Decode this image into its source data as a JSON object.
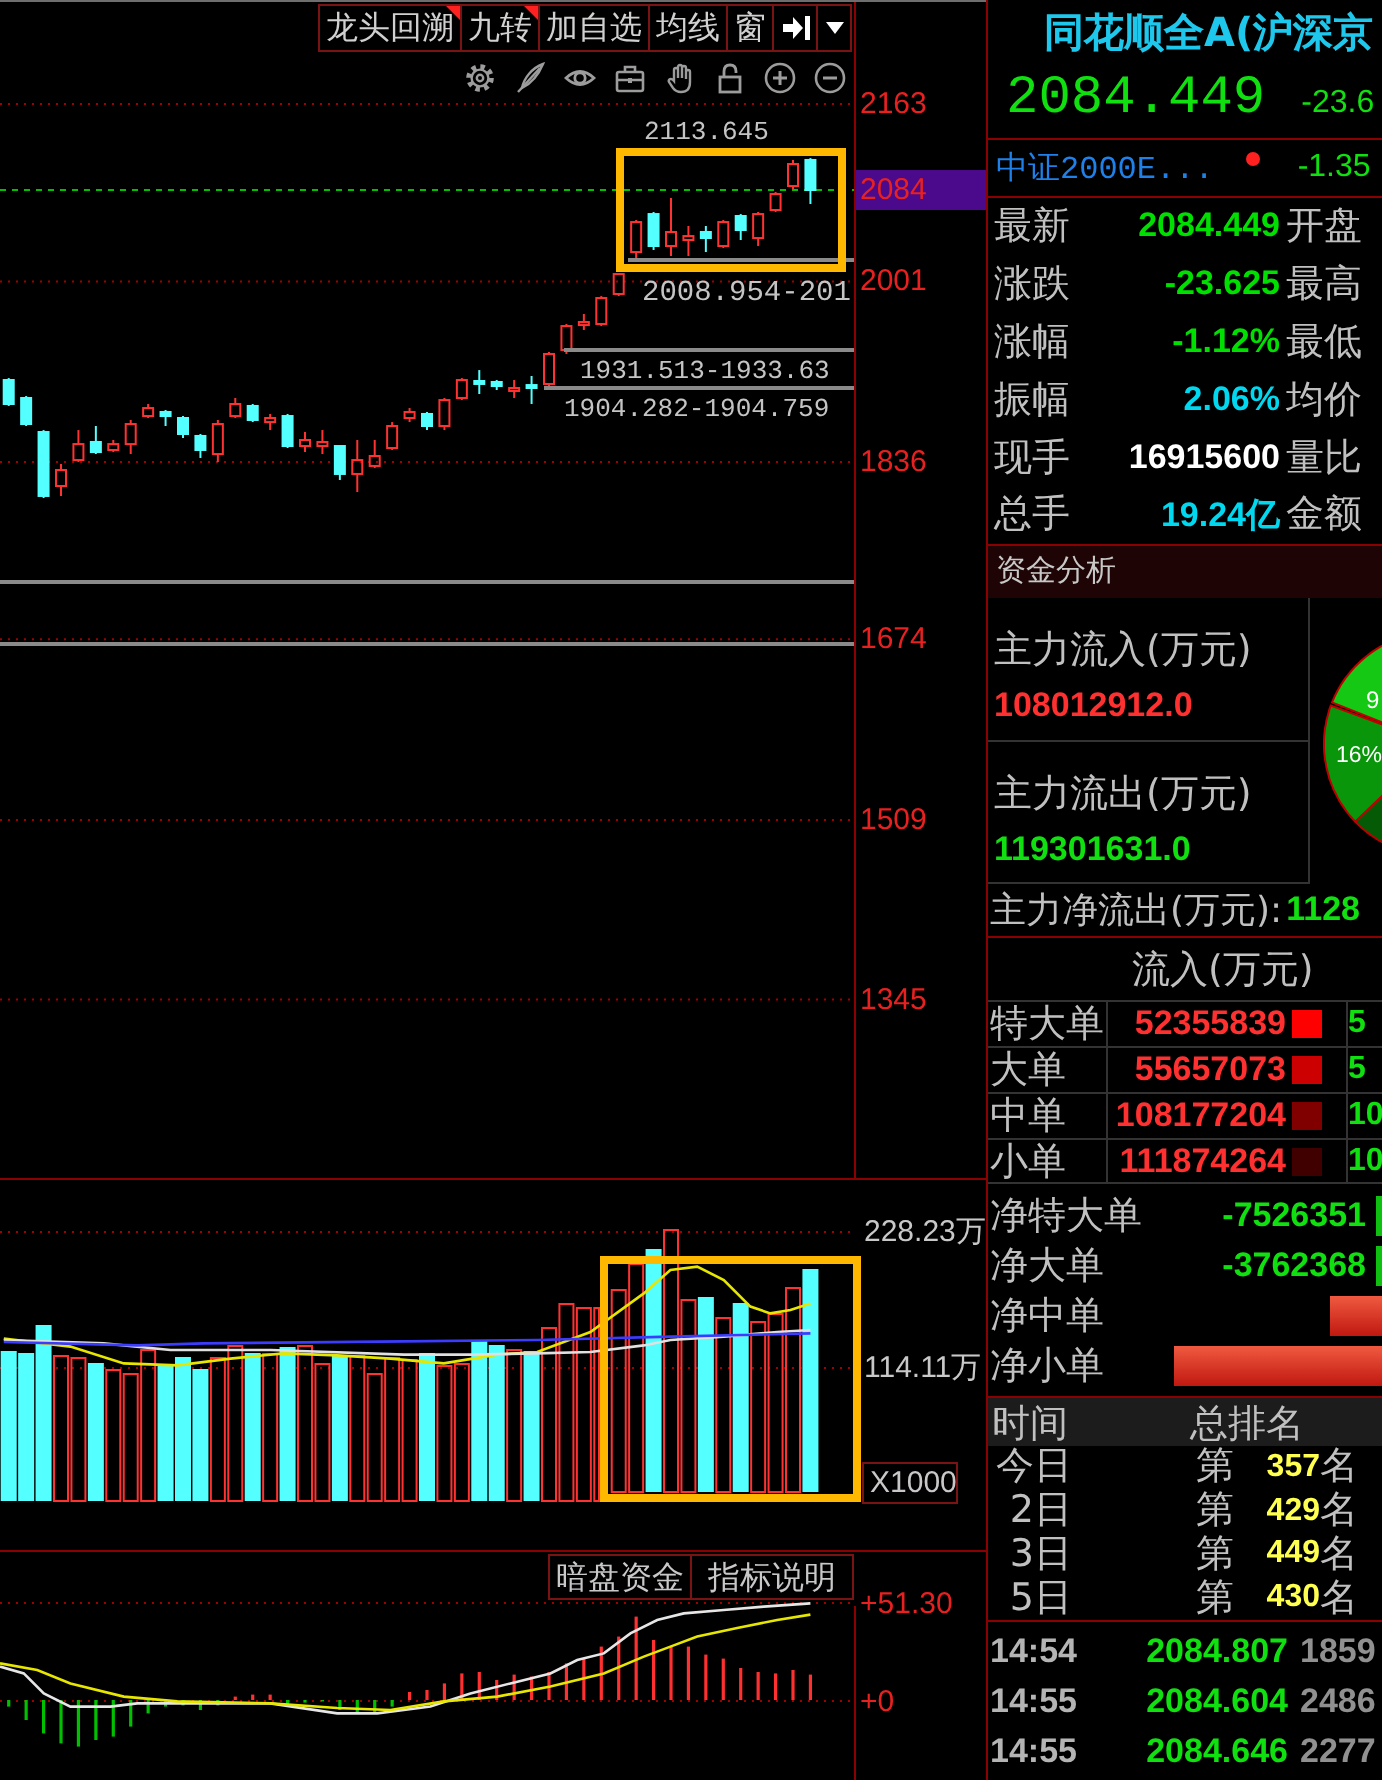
{
  "toolbar": [
    {
      "label": "龙头回溯",
      "flagged": true
    },
    {
      "label": "九转",
      "flagged": true
    },
    {
      "label": "加自选",
      "flagged": false
    },
    {
      "label": "均线",
      "flagged": false
    },
    {
      "label": "窗",
      "flagged": false
    }
  ],
  "price_chart": {
    "chart_data": {
      "type": "candlestick",
      "ohlc": [
        [
          1910.9,
          1912.7,
          1887.2,
          1889.0
        ],
        [
          1894.5,
          1896.3,
          1868.9,
          1870.7
        ],
        [
          1863.4,
          1865.2,
          1803.1,
          1805.0
        ],
        [
          1814.1,
          1834.2,
          1805.0,
          1828.7
        ],
        [
          1837.8,
          1865.2,
          1836.0,
          1852.4
        ],
        [
          1854.3,
          1868.9,
          1843.3,
          1845.1
        ],
        [
          1847.0,
          1856.1,
          1845.1,
          1852.4
        ],
        [
          1852.4,
          1874.4,
          1843.3,
          1870.7
        ],
        [
          1878.0,
          1889.0,
          1876.2,
          1885.3
        ],
        [
          1881.7,
          1883.5,
          1868.9,
          1878.0
        ],
        [
          1876.2,
          1878.0,
          1857.9,
          1861.6
        ],
        [
          1859.8,
          1861.6,
          1839.7,
          1847.0
        ],
        [
          1843.3,
          1874.4,
          1836.0,
          1870.7
        ],
        [
          1878.0,
          1894.5,
          1876.2,
          1889.0
        ],
        [
          1887.2,
          1889.0,
          1872.5,
          1874.4
        ],
        [
          1872.5,
          1879.9,
          1865.2,
          1876.2
        ],
        [
          1878.0,
          1879.9,
          1848.8,
          1850.6
        ],
        [
          1850.6,
          1863.4,
          1845.1,
          1856.1
        ],
        [
          1850.6,
          1865.2,
          1843.3,
          1854.3
        ],
        [
          1850.6,
          1850.6,
          1819.6,
          1825.1
        ],
        [
          1825.1,
          1856.1,
          1808.6,
          1837.8
        ],
        [
          1832.4,
          1856.1,
          1830.5,
          1841.5
        ],
        [
          1848.8,
          1872.5,
          1847.0,
          1868.9
        ],
        [
          1876.2,
          1885.3,
          1872.5,
          1881.7
        ],
        [
          1879.9,
          1881.7,
          1865.2,
          1868.9
        ],
        [
          1868.9,
          1894.5,
          1865.2,
          1892.6
        ],
        [
          1894.5,
          1912.7,
          1892.6,
          1910.9
        ],
        [
          1910.0,
          1920.0,
          1898.1,
          1907.3
        ],
        [
          1909.1,
          1910.9,
          1901.8,
          1905.4
        ],
        [
          1900.9,
          1910.9,
          1894.5,
          1903.6
        ],
        [
          1906.3,
          1914.6,
          1889.0,
          1903.6
        ],
        [
          1907.3,
          1936.5,
          1905.4,
          1934.7
        ],
        [
          1938.3,
          1962.1,
          1934.7,
          1960.2
        ],
        [
          1961.1,
          1971.2,
          1956.6,
          1963.9
        ],
        [
          1962.1,
          1987.6,
          1960.2,
          1985.8
        ],
        [
          1989.5,
          2008.5,
          1987.6,
          2007.7
        ],
        [
          2027.8,
          2057.1,
          2019.0,
          2055.2
        ],
        [
          2062.5,
          2064.4,
          2029.7,
          2033.3
        ],
        [
          2033.3,
          2077.2,
          2024.2,
          2046.1
        ],
        [
          2038.8,
          2051.6,
          2024.2,
          2042.4
        ],
        [
          2046.1,
          2051.6,
          2027.8,
          2040.6
        ],
        [
          2033.3,
          2057.1,
          2031.5,
          2055.2
        ],
        [
          2060.7,
          2062.5,
          2038.8,
          2047.9
        ],
        [
          2040.6,
          2064.4,
          2033.3,
          2062.5
        ],
        [
          2066.2,
          2082.6,
          2064.4,
          2080.8
        ],
        [
          2088.1,
          2111.9,
          2084.5,
          2108.2
        ],
        [
          2111.9,
          2113.645,
          2071.7,
          2084.449
        ],
        null,
        null
      ],
      "ylim": [
        1182.0,
        2208.7
      ],
      "yticks": [
        2163,
        2001,
        1836,
        1674,
        1509,
        1345
      ],
      "grid": true,
      "ref_lines": [
        {
          "axis": "y",
          "value": 2084.449,
          "color": "#00c000"
        },
        {
          "axis": "y",
          "value": 1726.4,
          "color": "#8a8a8a"
        },
        {
          "axis": "y",
          "value": 1669.8,
          "color": "#8a8a8a"
        }
      ]
    },
    "current_price": "2084",
    "annotations": [
      "2113.645",
      "2008.954-201",
      "1931.513-1933.63",
      "1904.282-1904.759"
    ]
  },
  "volume_chart": {
    "axis_labels": [
      "228.23万",
      "114.11万"
    ],
    "unit": "X1000"
  },
  "indicator_chart": {
    "buttons": [
      "暗盘资金",
      "指标说明"
    ],
    "axis_labels": [
      "+51.30",
      "+0"
    ]
  },
  "quote": {
    "name": "同花顺全A(沪深京",
    "price": "2084.449",
    "change": "-23.6",
    "related_index": {
      "name": "中证2000E...",
      "change": "-1.35"
    }
  },
  "quote_fields": [
    {
      "label": "最新",
      "value": "2084.449",
      "color": "#00e000",
      "label_right": "开盘"
    },
    {
      "label": "涨跌",
      "value": "-23.625",
      "color": "#00e000",
      "label_right": "最高"
    },
    {
      "label": "涨幅",
      "value": "-1.12%",
      "color": "#00e000",
      "label_right": "最低"
    },
    {
      "label": "振幅",
      "value": "2.06%",
      "color": "#00d8f0",
      "label_right": "均价"
    },
    {
      "label": "现手",
      "value": "16915600",
      "color": "#ffffff",
      "label_right": "量比"
    },
    {
      "label": "总手",
      "value": "19.24亿",
      "color": "#00d8f0",
      "label_right": "金额"
    }
  ],
  "fund_analysis": {
    "title": "资金分析",
    "inflow": {
      "label": "主力流入(万元)",
      "value": "108012912.0"
    },
    "outflow": {
      "label": "主力流出(万元)",
      "value": "119301631.0"
    },
    "pie_labels": [
      "9",
      "16%"
    ],
    "net": {
      "label": "主力净流出(万元):",
      "value": "1128"
    }
  },
  "flow_table": {
    "header": "流入(万元)",
    "rows": [
      {
        "label": "特大单",
        "inflow": "52355839",
        "color": "#ff0000",
        "column_3": "5"
      },
      {
        "label": "大单",
        "inflow": "55657073",
        "color": "#cc0000",
        "column_3": "5"
      },
      {
        "label": "中单",
        "inflow": "108177204",
        "color": "#800000",
        "column_3": "10"
      },
      {
        "label": "小单",
        "inflow": "111874264",
        "color": "#400000",
        "column_3": "10"
      }
    ]
  },
  "net_flows": [
    {
      "label": "净特大单",
      "value": "-7526351"
    },
    {
      "label": "净大单",
      "value": "-3762368"
    },
    {
      "label": "净中单"
    },
    {
      "label": "净小单"
    }
  ],
  "ranking": {
    "columns": [
      "时间",
      "总排名"
    ],
    "rows": [
      {
        "period": "今日",
        "prefix": "第",
        "rank": "357",
        "suffix": "名"
      },
      {
        "period": "2日",
        "prefix": "第",
        "rank": "429",
        "suffix": "名"
      },
      {
        "period": "3日",
        "prefix": "第",
        "rank": "449",
        "suffix": "名"
      },
      {
        "period": "5日",
        "prefix": "第",
        "rank": "430",
        "suffix": "名"
      }
    ]
  },
  "ticks": [
    {
      "time": "14:54",
      "price": "2084.807",
      "volume": "1859"
    },
    {
      "time": "14:55",
      "price": "2084.604",
      "volume": "2486"
    },
    {
      "time": "14:55",
      "price": "2084.646",
      "volume": "2277"
    }
  ]
}
